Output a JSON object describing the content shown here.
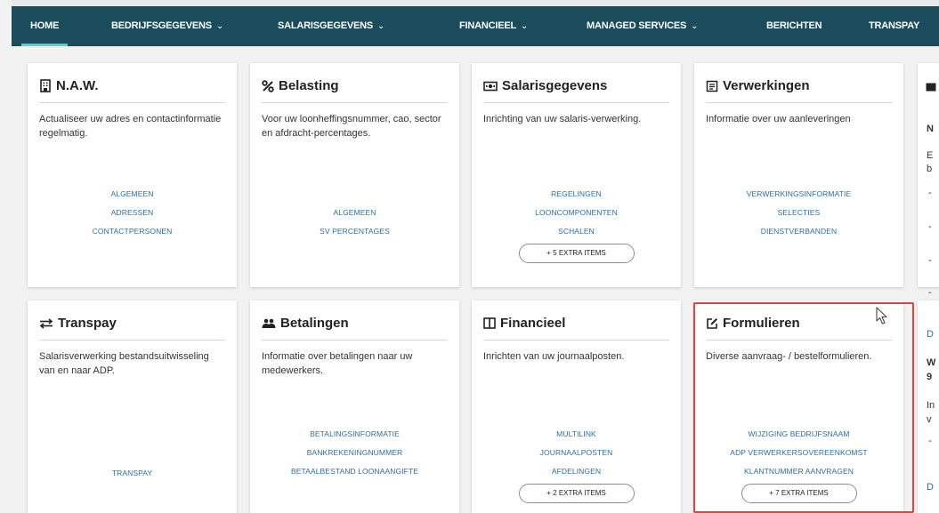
{
  "nav": [
    {
      "label": "HOME",
      "dropdown": false,
      "active": true
    },
    {
      "label": "BEDRIJFSGEGEVENS",
      "dropdown": true,
      "active": false
    },
    {
      "label": "SALARISGEGEVENS",
      "dropdown": true,
      "active": false
    },
    {
      "label": "FINANCIEEL",
      "dropdown": true,
      "active": false
    },
    {
      "label": "MANAGED SERVICES",
      "dropdown": true,
      "active": false
    },
    {
      "label": "BERICHTEN",
      "dropdown": false,
      "active": false
    },
    {
      "label": "TRANSPAY",
      "dropdown": false,
      "active": false
    }
  ],
  "cards": {
    "naw": {
      "title": "N.A.W.",
      "icon": "building-icon",
      "description": "Actualiseer uw adres en contactinformatie regelmatig.",
      "links": [
        "ALGEMEEN",
        "ADRESSEN",
        "CONTACTPERSONEN"
      ]
    },
    "belasting": {
      "title": "Belasting",
      "icon": "percent-icon",
      "description": "Voor uw loonheffingsnummer, cao, sector en afdracht-percentages.",
      "links": [
        "ALGEMEEN",
        "SV PERCENTAGES"
      ]
    },
    "salarisgegevens": {
      "title": "Salarisgegevens",
      "icon": "money-icon",
      "description": "Inrichting van uw salaris-verwerking.",
      "links": [
        "REGELINGEN",
        "LOONCOMPONENTEN",
        "SCHALEN"
      ],
      "extra": "+ 5 EXTRA ITEMS"
    },
    "verwerkingen": {
      "title": "Verwerkingen",
      "icon": "report-icon",
      "description": "Informatie over uw aanleveringen",
      "links": [
        "VERWERKINGSINFORMATIE",
        "SELECTIES",
        "DIENSTVERBANDEN"
      ]
    },
    "transpay": {
      "title": "Transpay",
      "icon": "transfer-arrows-icon",
      "description": "Salarisverwerking bestandsuitwisseling van en naar ADP.",
      "links": [
        "TRANSPAY"
      ]
    },
    "betalingen": {
      "title": "Betalingen",
      "icon": "people-icon",
      "description": "Informatie over betalingen naar uw medewerkers.",
      "links": [
        "BETALINGSINFORMATIE",
        "BANKREKENINGNUMMER",
        "BETAALBESTAND LOONAANGIFTE"
      ]
    },
    "financieel": {
      "title": "Financieel",
      "icon": "columns-icon",
      "description": "Inrichten van uw journaalposten.",
      "links": [
        "MULTILINK",
        "JOURNAALPOSTEN",
        "AFDELINGEN"
      ],
      "extra": "+ 2 EXTRA ITEMS"
    },
    "formulieren": {
      "title": "Formulieren",
      "icon": "edit-form-icon",
      "description": "Diverse aanvraag- / bestelformulieren.",
      "links": [
        "WIJZIGING BEDRIJFSNAAM",
        "ADP VERWERKERSOVEREENKOMST",
        "KLANTNUMMER AANVRAGEN"
      ],
      "extra": "+ 7 EXTRA ITEMS"
    }
  },
  "side_partial": {
    "lines": [
      "N",
      "E",
      "b",
      "-",
      "-",
      "-",
      "-",
      "D",
      "W",
      "9",
      "In",
      "v",
      "-",
      "D"
    ]
  },
  "colors": {
    "navbar": "#1b4c5c",
    "link": "#2b6fa3",
    "highlight": "#e0443c",
    "active_underline": "#4fd1e0"
  }
}
